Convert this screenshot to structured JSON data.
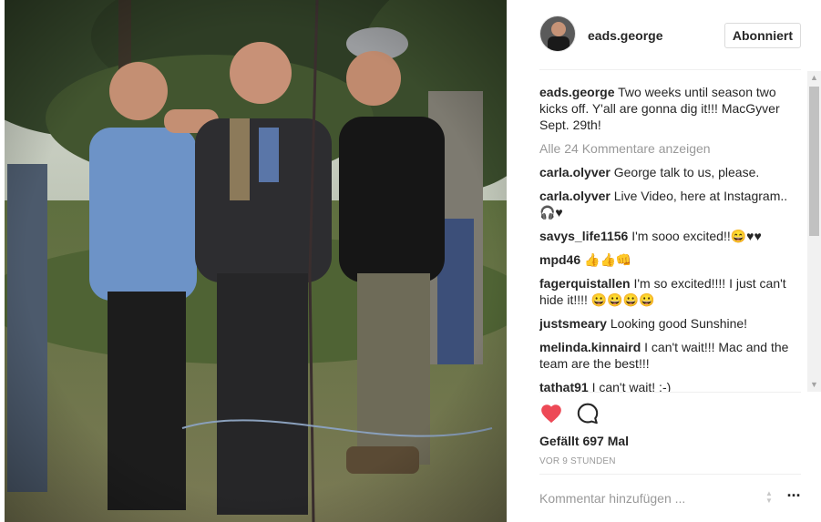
{
  "post": {
    "username": "eads.george",
    "follow_label": "Abonniert",
    "caption": "Two weeks until season two kicks off. Y'all are gonna dig it!!! MacGyver Sept. 29th!",
    "load_more": "Alle 24 Kommentare anzeigen",
    "comments": [
      {
        "user": "carla.olyver",
        "text": "George talk to us, please."
      },
      {
        "user": "carla.olyver",
        "text": "Live Video, here at Instagram.. 🎧♥"
      },
      {
        "user": "savys_life1156",
        "text": "I'm sooo excited!!😄♥♥"
      },
      {
        "user": "mpd46",
        "text": "👍👍👊"
      },
      {
        "user": "fagerquistallen",
        "text": "I'm so excited!!!! I just can't hide it!!!! 😀😀😀😀"
      },
      {
        "user": "justsmeary",
        "text": "Looking good Sunshine!"
      },
      {
        "user": "melinda.kinnaird",
        "text": "I can't wait!!! Mac and the team are the best!!!"
      },
      {
        "user": "tathat91",
        "text": "I can't wait! :-)"
      }
    ],
    "likes": "Gefällt 697 Mal",
    "time": "VOR 9 STUNDEN",
    "add_comment_placeholder": "Kommentar hinzufügen ...",
    "liked": true
  },
  "colors": {
    "heart": "#ed4956",
    "text": "#262626",
    "muted": "#999999",
    "border": "#efefef"
  },
  "icons": {
    "like": "heart-icon",
    "comment": "speech-bubble-icon",
    "more": "ellipsis-icon"
  }
}
